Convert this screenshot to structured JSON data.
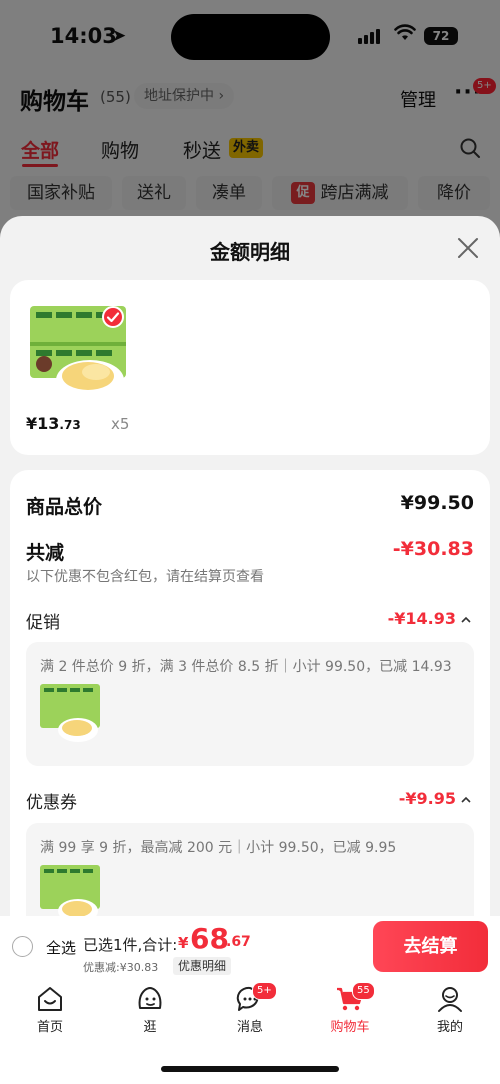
{
  "status_bar": {
    "time": "14:03",
    "battery": "72"
  },
  "header": {
    "title": "购物车",
    "count": "(55)",
    "address": "地址保护中",
    "manage": "管理",
    "more_badge": "5+"
  },
  "tabs": [
    {
      "label": "全部"
    },
    {
      "label": "购物"
    },
    {
      "label": "秒送"
    }
  ],
  "tab_tag": "外卖",
  "chips": [
    {
      "label": "国家补贴"
    },
    {
      "label": "送礼"
    },
    {
      "label": "凑单"
    },
    {
      "label": "跨店满减",
      "tag": "促"
    },
    {
      "label": "降价"
    }
  ],
  "sheet": {
    "title": "金额明细",
    "product": {
      "price_int": "¥13",
      "price_dec": ".73",
      "qty": "x5"
    },
    "total_label": "商品总价",
    "total_value": "¥99.50",
    "reduce_label": "共减",
    "reduce_value": "-¥30.83",
    "note": "以下优惠不包含红包，请在结算页查看",
    "promo": {
      "label": "促销",
      "value": "-¥14.93",
      "desc": "满 2 件总价 9 折，满 3 件总价 8.5 折｜小计 99.50，已减 14.93"
    },
    "coupon": {
      "label": "优惠券",
      "value": "-¥9.95",
      "desc": "满 99 享 9 折，最高减 200 元｜小计 99.50，已减 9.95"
    }
  },
  "checkout": {
    "select_all": "全选",
    "selected": "已选1件,合计:",
    "yen": "¥",
    "total_int": "68",
    "total_dec": ".67",
    "discount": "优惠减:¥30.83",
    "detail_tag": "优惠明细",
    "button": "去结算"
  },
  "tabbar": [
    {
      "label": "首页",
      "icon": "home-icon"
    },
    {
      "label": "逛",
      "icon": "explore-icon"
    },
    {
      "label": "消息",
      "icon": "message-icon",
      "badge": "5+"
    },
    {
      "label": "购物车",
      "icon": "cart-icon",
      "badge": "55"
    },
    {
      "label": "我的",
      "icon": "profile-icon"
    }
  ],
  "colors": {
    "accent": "#f22d3a",
    "overlay": "rgba(0,0,0,0.48)"
  }
}
